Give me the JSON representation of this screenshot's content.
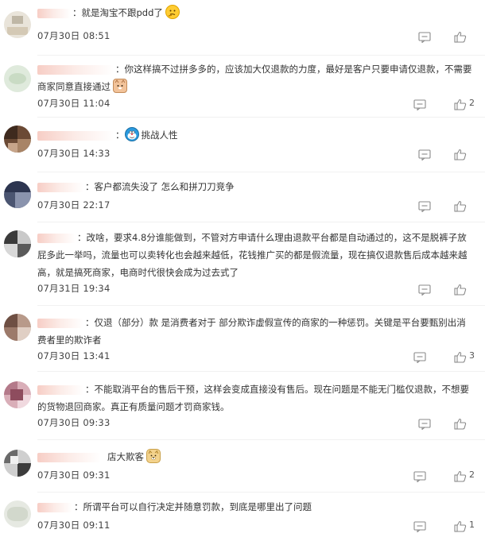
{
  "comments": [
    {
      "text": "就是淘宝不跟pdd了",
      "time": "07月30日 08:51",
      "likes": "",
      "emoji": "thinking-face-emoji"
    },
    {
      "text": "你这样搞不过拼多多的，应该加大仅退款的力度，最好是客户只要申请仅退款，不需要商家同意直接通过",
      "time": "07月30日 11:04",
      "likes": "2",
      "emoji": "doge-cat-emoji"
    },
    {
      "text": "挑战人性",
      "time": "07月30日 14:33",
      "likes": "",
      "emoji": "doraemon-emoji"
    },
    {
      "text": "客户都流失没了 怎么和拼刀刀竞争",
      "time": "07月30日 22:17",
      "likes": "",
      "emoji": ""
    },
    {
      "text": "改啥，要求4.8分谁能做到，不管对方申请什么理由退款平台都是自动通过的，这不是脱裤子放屁多此一举吗，流量也可以卖转化也会越来越低，花钱推广买的都是假流量，现在搞仅退款售后成本越来越高，就是搞死商家，电商时代很快会成为过去式了",
      "time": "07月31日 19:34",
      "likes": "",
      "emoji": ""
    },
    {
      "text": "仅退（部分）款 是消费者对于 部分欺诈虚假宣传的商家的一种惩罚。关键是平台要甄别出消费者里的欺诈者",
      "time": "07月30日 13:41",
      "likes": "3",
      "emoji": ""
    },
    {
      "text": "不能取消平台的售后干预，这样会变成直接没有售后。现在问题是不能无门槛仅退款，不想要的货物退回商家。真正有质量问题才罚商家钱。",
      "time": "07月30日 09:33",
      "likes": "",
      "emoji": ""
    },
    {
      "text": "店大欺客",
      "time": "07月30日 09:31",
      "likes": "2",
      "emoji": "doge-emoji"
    },
    {
      "text": "所谓平台可以自行决定并随意罚款，到底是哪里出了问题",
      "time": "07月30日 09:11",
      "likes": "1",
      "emoji": ""
    }
  ],
  "colors": {
    "text": "#333333",
    "meta": "#444444",
    "icon": "#8a8a8a"
  }
}
